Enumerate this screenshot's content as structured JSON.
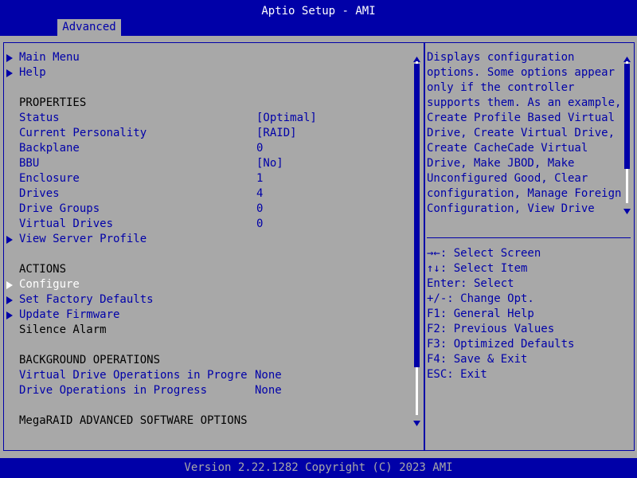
{
  "window": {
    "title": "Aptio Setup - AMI"
  },
  "tabs": [
    {
      "label": "Advanced"
    }
  ],
  "menu": {
    "nav": [
      {
        "label": "Main Menu"
      },
      {
        "label": "Help"
      }
    ],
    "properties": {
      "heading": "PROPERTIES",
      "items": [
        {
          "label": "Status",
          "value": "[Optimal]"
        },
        {
          "label": "Current Personality",
          "value": "[RAID]"
        },
        {
          "label": "Backplane",
          "value": "0"
        },
        {
          "label": "BBU",
          "value": "[No]"
        },
        {
          "label": "Enclosure",
          "value": "1"
        },
        {
          "label": "Drives",
          "value": "4"
        },
        {
          "label": "Drive Groups",
          "value": "0"
        },
        {
          "label": "Virtual Drives",
          "value": "0"
        }
      ],
      "view_server_profile": "View Server Profile"
    },
    "actions": {
      "heading": "ACTIONS",
      "configure": "Configure",
      "set_factory_defaults": "Set Factory Defaults",
      "update_firmware": "Update Firmware",
      "silence_alarm": "Silence Alarm"
    },
    "background": {
      "heading": "BACKGROUND OPERATIONS",
      "items": [
        {
          "label": "Virtual Drive Operations in Progre",
          "value": "None"
        },
        {
          "label": "Drive Operations in Progress",
          "value": "None"
        }
      ]
    },
    "software_options": "MegaRAID ADVANCED SOFTWARE OPTIONS"
  },
  "help_text": [
    "Displays configuration",
    "options. Some options appear",
    "only if the controller",
    "supports them. As an example,",
    "Create Profile Based Virtual",
    "Drive, Create Virtual Drive,",
    "Create CacheCade Virtual",
    "Drive, Make JBOD, Make",
    "Unconfigured Good, Clear",
    "configuration, Manage Foreign",
    "Configuration, View Drive"
  ],
  "key_help": [
    "→←: Select Screen",
    "↑↓: Select Item",
    "Enter: Select",
    "+/-: Change Opt.",
    "F1: General Help",
    "F2: Previous Values",
    "F3: Optimized Defaults",
    "F4: Save & Exit",
    "ESC: Exit"
  ],
  "footer": {
    "text": "Version 2.22.1282 Copyright (C) 2023 AMI"
  },
  "colors": {
    "background": "#0000a8",
    "panel": "#a8a8a8",
    "text": "#0000a8",
    "selected": "#ffffff"
  },
  "icons": {
    "submenu": "triangle-right-icon",
    "scroll_up": "triangle-up-icon",
    "scroll_down": "triangle-down-icon"
  }
}
